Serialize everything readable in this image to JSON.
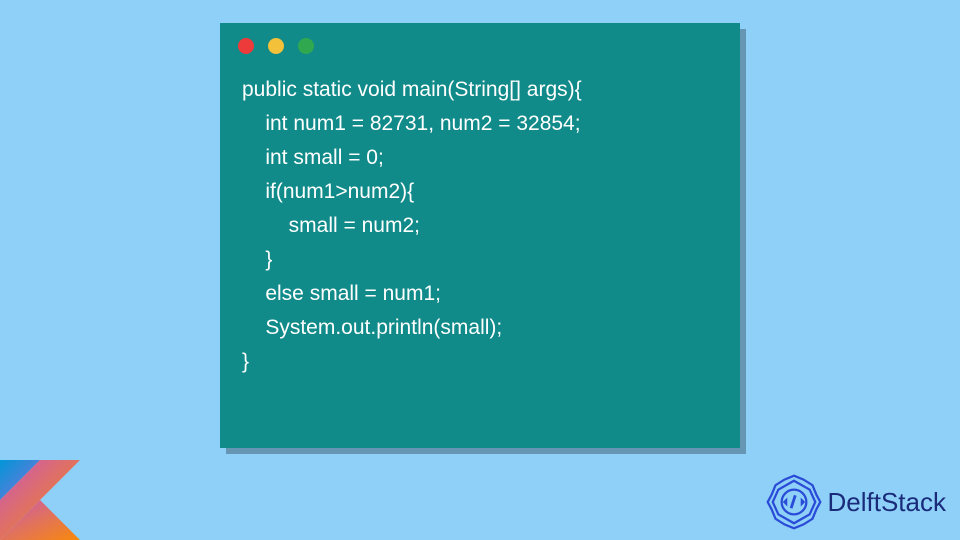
{
  "code_lines": {
    "l1": "public static void main(String[] args){",
    "l2": "    int num1 = 82731, num2 = 32854;",
    "l3": "    int small = 0;",
    "l4": "    if(num1>num2){",
    "l5": "        small = num2;",
    "l6": "    }",
    "l7": "    else small = num1;",
    "l8": "    System.out.println(small);",
    "l9": "}"
  },
  "brand": {
    "name": "DelftStack"
  },
  "colors": {
    "background": "#8ed0f8",
    "window": "#118a8a",
    "dot_red": "#ed3b3b",
    "dot_yellow": "#f3c13a",
    "dot_green": "#2fa84f",
    "brand_text": "#1a2b7a"
  }
}
